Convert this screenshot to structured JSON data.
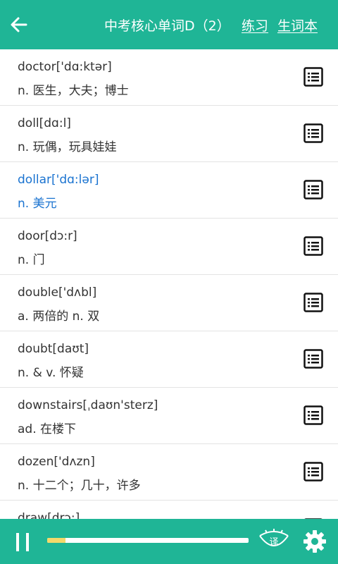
{
  "header": {
    "back_icon": "back-arrow-icon",
    "title": "中考核心单词D（2）",
    "practice_label": "练习",
    "vocab_book_label": "生词本"
  },
  "colors": {
    "accent": "#1fb596",
    "active_text": "#1a73d0",
    "progress": "#f3d96a"
  },
  "words": [
    {
      "word": "doctor['dɑ:ktər]",
      "meaning": "n. 医生，大夫；博士",
      "active": false
    },
    {
      "word": "doll[dɑ:l]",
      "meaning": "n. 玩偶，玩具娃娃",
      "active": false
    },
    {
      "word": "dollar['dɑ:lər]",
      "meaning": "n. 美元",
      "active": true
    },
    {
      "word": "door[dɔ:r]",
      "meaning": "n. 门",
      "active": false
    },
    {
      "word": "double['dʌbl]",
      "meaning": "a. 两倍的 n. 双",
      "active": false
    },
    {
      "word": "doubt[daʊt]",
      "meaning": "n. & v. 怀疑",
      "active": false
    },
    {
      "word": "downstairs[ˌdaʊn'sterz]",
      "meaning": "ad. 在楼下",
      "active": false
    },
    {
      "word": "dozen['dʌzn]",
      "meaning": "n. 十二个；几十，许多",
      "active": false
    },
    {
      "word": "draw[drɔ:]",
      "meaning": "",
      "active": false
    }
  ],
  "player": {
    "pause_icon": "pause-icon",
    "progress_fraction": 0.09,
    "translate_label": "译",
    "settings_icon": "gear-icon"
  }
}
